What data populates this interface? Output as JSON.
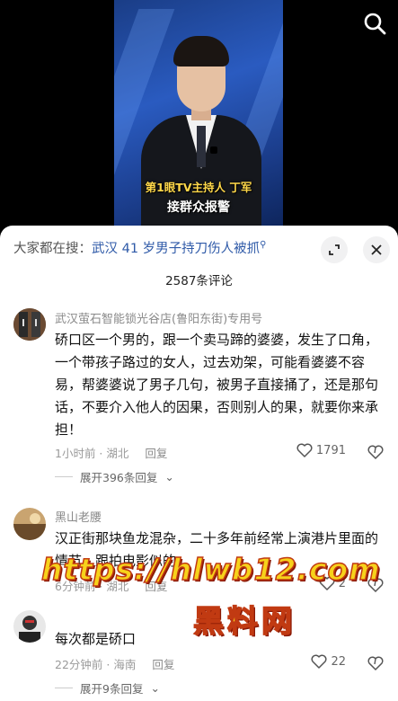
{
  "video": {
    "caption_line1": "第1眼TV主持人 丁军",
    "caption_line2": "接群众报警",
    "search_icon": "search-icon"
  },
  "sheet": {
    "search_prefix": "大家都在搜：",
    "search_keyword": "武汉 41 岁男子持刀伤人被抓",
    "search_icon": "mini-search-icon",
    "comment_count": "2587条评论",
    "colors": {
      "link": "#2f5aa8",
      "meta": "#9a9a9a",
      "background": "#ffffff"
    }
  },
  "comments": [
    {
      "author": "武汉萤石智能锁光谷店(鲁阳东街)专用号",
      "text": "硚口区一个男的，跟一个卖马蹄的婆婆，发生了口角，一个带孩子路过的女人，过去劝架，可能看婆婆不容易，帮婆婆说了男子几句，被男子直接捅了，还是那句话，不要介入他人的因果，否则别人的果，就要你来承担！",
      "time": "1小时前 · 湖北",
      "reply_label": "回复",
      "likes": "1791",
      "expand_label": "展开396条回复"
    },
    {
      "author": "黑山老腰",
      "text": "汉正街那块鱼龙混杂，二十多年前经常上演港片里面的情节，跟拍电影似的",
      "time": "6分钟前 · 湖北",
      "reply_label": "回复",
      "likes": "2"
    },
    {
      "author": "",
      "text": "每次都是硚口",
      "time": "22分钟前 · 海南",
      "reply_label": "回复",
      "likes": "22",
      "expand_label": "展开9条回复"
    }
  ],
  "watermark": {
    "url": "https://hlwb12.com",
    "name": "黑料网"
  }
}
